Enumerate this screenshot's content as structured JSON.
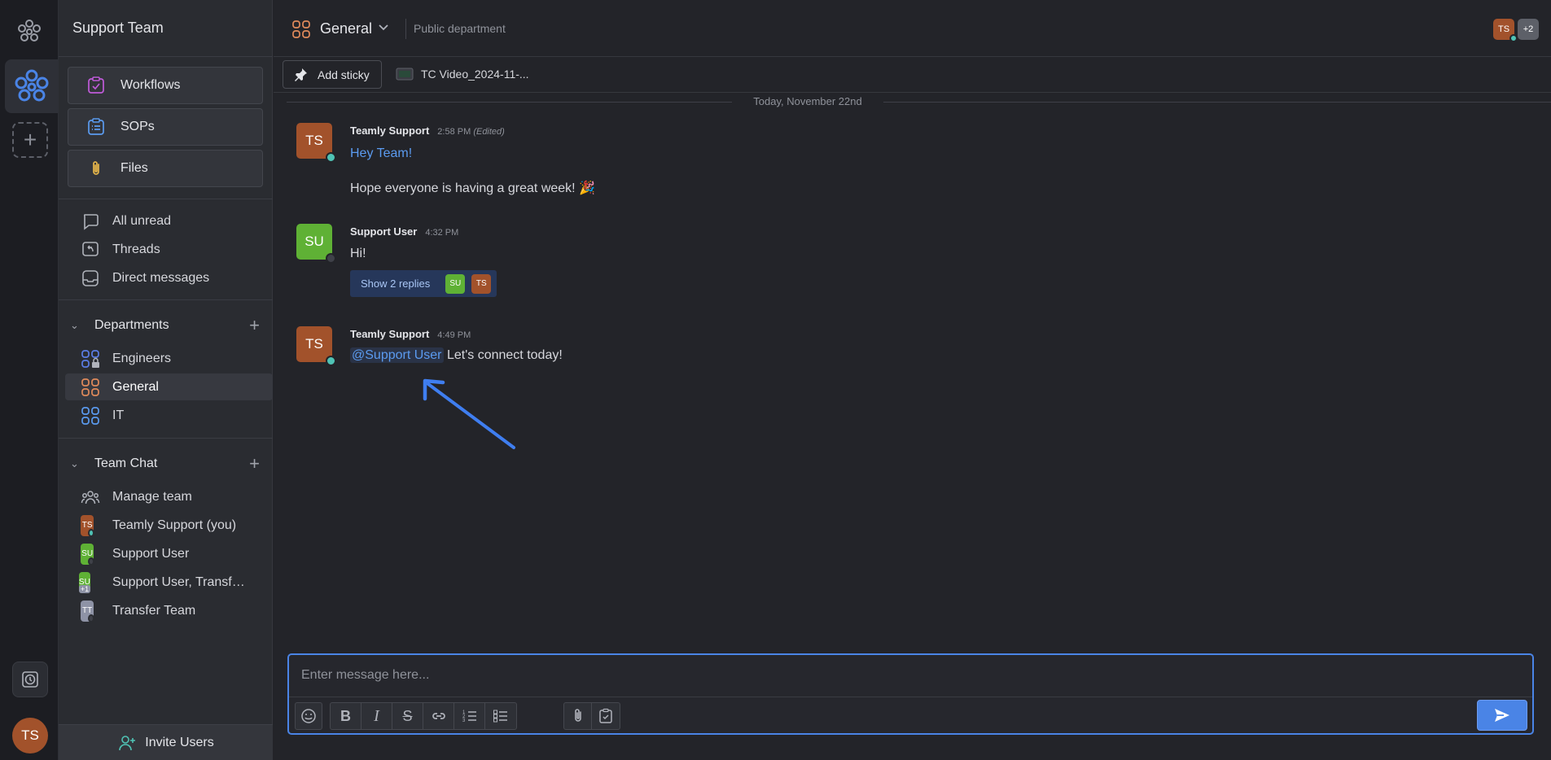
{
  "team": {
    "title": "Support Team"
  },
  "user": {
    "initials": "TS"
  },
  "sidebar": {
    "pinned": [
      {
        "label": "Workflows",
        "icon": "workflow-icon"
      },
      {
        "label": "SOPs",
        "icon": "clipboard-list-icon"
      },
      {
        "label": "Files",
        "icon": "paperclip-icon"
      }
    ],
    "nav": [
      {
        "label": "All unread",
        "icon": "chat-bubble-icon"
      },
      {
        "label": "Threads",
        "icon": "threads-icon"
      },
      {
        "label": "Direct messages",
        "icon": "inbox-icon"
      }
    ],
    "departments": {
      "title": "Departments",
      "items": [
        {
          "label": "Engineers",
          "icon": "department-locked-icon"
        },
        {
          "label": "General",
          "icon": "department-icon"
        },
        {
          "label": "IT",
          "icon": "department-icon"
        }
      ]
    },
    "team_chat": {
      "title": "Team Chat",
      "items": [
        {
          "label": "Manage team",
          "icon": "people-icon"
        },
        {
          "label": "Teamly Support (you)",
          "initials": "TS"
        },
        {
          "label": "Support User",
          "initials": "SU"
        },
        {
          "label": "Support User, Transfer Team",
          "initials": "SU",
          "badge": "+1"
        },
        {
          "label": "Transfer Team",
          "initials": "TT"
        }
      ]
    },
    "invite_label": "Invite Users"
  },
  "channel": {
    "name": "General",
    "subtitle": "Public department",
    "members": [
      "TS"
    ],
    "members_more": "+2"
  },
  "toolbar": {
    "sticky_label": "Add sticky",
    "file_label": "TC Video_2024-11-..."
  },
  "date_divider": "Today, November 22nd",
  "messages": [
    {
      "initials": "TS",
      "author": "Teamly Support",
      "time": "2:58 PM",
      "edited": "(Edited)",
      "line1": "Hey Team!",
      "line2": "Hope everyone is having a great week! 🎉"
    },
    {
      "initials": "SU",
      "author": "Support User",
      "time": "4:32 PM",
      "line1": "Hi!",
      "replies_label": "Show 2 replies",
      "reply_avatars": [
        "SU",
        "TS"
      ]
    },
    {
      "initials": "TS",
      "author": "Teamly Support",
      "time": "4:49 PM",
      "mention": "@Support User",
      "line1": "Let's connect today!"
    }
  ],
  "composer": {
    "placeholder": "Enter message here..."
  },
  "colors": {
    "accent": "#4a84e6",
    "ts_avatar": "#a2522b",
    "su_avatar": "#5fb135",
    "tt_avatar": "#8e93a6",
    "online": "#4fc3b5",
    "offline": "#3f4149"
  }
}
